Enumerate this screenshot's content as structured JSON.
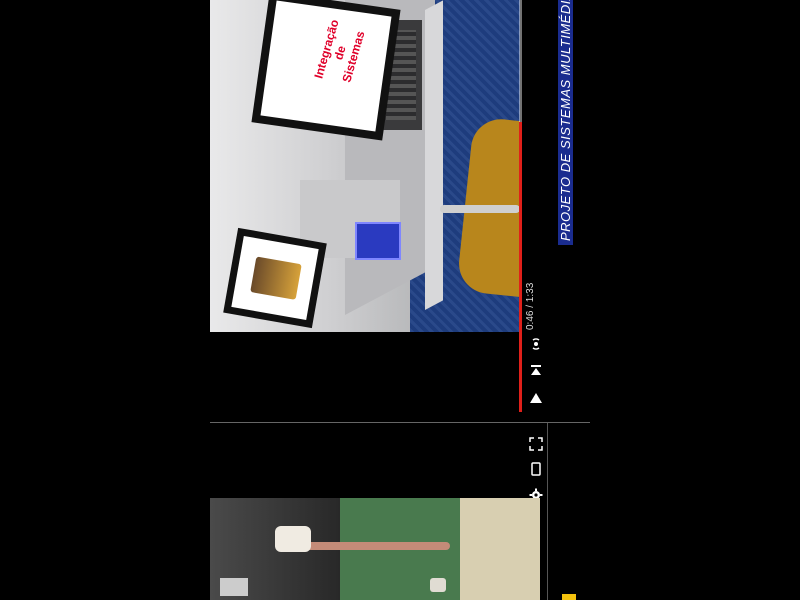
{
  "player": {
    "time_display": "0:46 / 1:33",
    "title_overlay": "PROJETO DE SISTEMAS MULTIMÉDIA",
    "progress_fraction": 0.49,
    "accent_color": "#e0201a",
    "title_bg_color": "#1a2c8f"
  },
  "scene": {
    "monitor_text_line1": "Integração",
    "monitor_text_line2": "de",
    "monitor_text_line3": "Sistemas"
  },
  "controls": {
    "broadcast_icon": "broadcast-icon",
    "skip_icon": "skip-icon",
    "play_icon": "play-icon",
    "fullscreen_icon": "fullscreen-icon",
    "phone_icon": "phone-icon",
    "settings_icon": "gear-icon"
  }
}
